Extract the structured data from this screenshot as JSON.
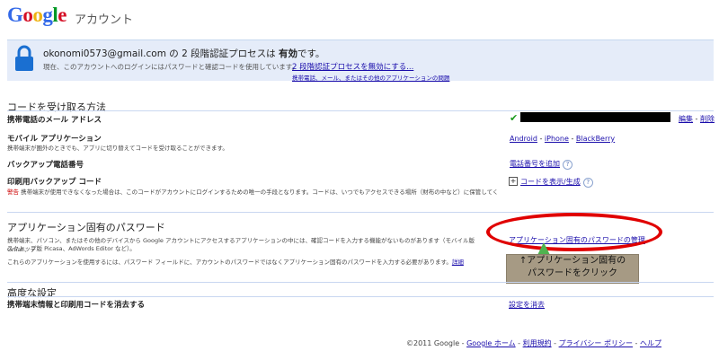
{
  "header": {
    "logo_text": "Google",
    "account_label": "アカウント"
  },
  "banner": {
    "email": "okonomi0573@gmail.com",
    "main_mid": " の 2 段階認証プロセスは ",
    "main_bold": "有効",
    "main_end": "です。",
    "sub": "現在、このアカウントへのログインにはパスワードと確認コードを使用しています。",
    "disable_link": "2 段階認証プロセスを無効にする...",
    "problem_link": "携帯電話、メール、またはその他のアプリケーションの問題"
  },
  "codes": {
    "title": "コードを受け取る方法",
    "sms_label": "携帯電話のメール アドレス",
    "edit": "編集",
    "sep": " - ",
    "delete": "削除",
    "mobile_app_label": "モバイル アプリケーション",
    "mobile_app_desc": "携帯端末が圏外のときでも、アプリに切り替えてコードを受け取ることができます。",
    "android": "Android",
    "iphone": "iPhone",
    "blackberry": "BlackBerry",
    "backup_phone_label": "バックアップ電話番号",
    "add_phone": "電話番号を追加",
    "printed_label": "印刷用バックアップ コード",
    "printed_warn": "警告",
    "printed_desc": "携帯端末が使用できなくなった場合は、このコードがアカウントにログインするための唯一の手段となります。コードは、いつでもアクセスできる場所（財布の中など）に保管してください",
    "show_codes": "コードを表示/生成"
  },
  "app_pw": {
    "title": "アプリケーション固有のパスワード",
    "desc1": "携帯端末、パソコン、またはその他のデバイスから Google アカウントにアクセスするアプリケーションの中には、確認コードを入力する機能がないものがあります（モバイル版 Gmail、デ",
    "desc2": "スクトップ版 Picasa、AdWords Editor など）。",
    "desc3": "これらのアプリケーションを使用するには、パスワード フィールドに、アカウントのパスワードではなくアプリケーション固有のパスワードを入力する必要があります。",
    "details": "詳細",
    "manage_link": "アプリケーション固有のパスワードの管理",
    "note_line1": "↑アプリケーション固有の",
    "note_line2": "パスワードをクリック"
  },
  "advanced": {
    "title": "高度な設定",
    "clear_label": "携帯端末情報と印刷用コードを消去する",
    "clear_link": "設定を消去"
  },
  "footer": {
    "copyright": "©2011 Google - ",
    "home": "Google ホーム",
    "terms": "利用規約",
    "privacy": "プライバシー ポリシー",
    "help": "ヘルプ",
    "sep": " - "
  },
  "colors": {
    "banner_bg": "#e5ecf9",
    "annotation_red": "#e00000",
    "note_bg": "#a69a84"
  },
  "icons": [
    "lock-icon",
    "check-icon",
    "help-icon",
    "plus-icon",
    "arrow-up-icon"
  ]
}
